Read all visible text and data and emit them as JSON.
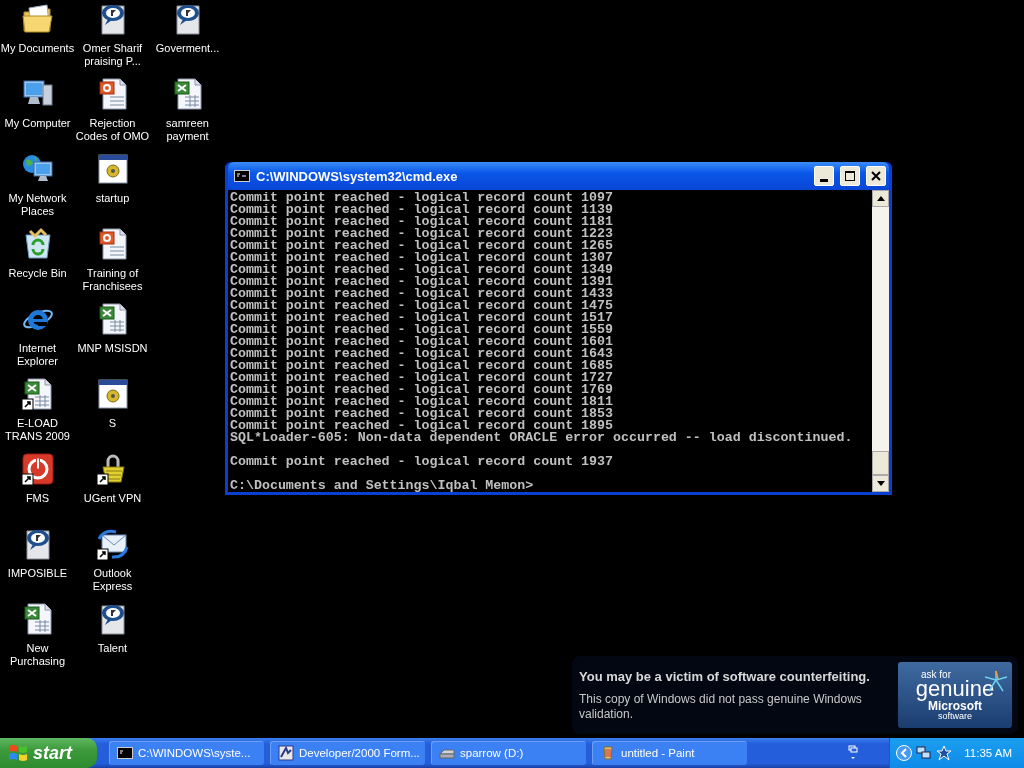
{
  "desktop_icons": [
    {
      "label": "My Documents",
      "kind": "folder",
      "shortcut": false
    },
    {
      "label": "My Computer",
      "kind": "computer",
      "shortcut": false
    },
    {
      "label": "My Network Places",
      "kind": "network",
      "shortcut": false
    },
    {
      "label": "Recycle Bin",
      "kind": "recycle",
      "shortcut": false
    },
    {
      "label": "Internet Explorer",
      "kind": "browser",
      "shortcut": false
    },
    {
      "label": "E-LOAD TRANS 2009",
      "kind": "spreadsheet",
      "shortcut": true
    },
    {
      "label": "FMS",
      "kind": "power",
      "shortcut": true
    },
    {
      "label": "IMPOSIBLE",
      "kind": "media",
      "shortcut": false
    },
    {
      "label": "New Purchasing",
      "kind": "spreadsheet",
      "shortcut": false
    },
    {
      "label": "Omer Sharif praising P...",
      "kind": "media",
      "shortcut": false
    },
    {
      "label": "Rejection Codes of OMO",
      "kind": "presentation",
      "shortcut": false
    },
    {
      "label": "startup",
      "kind": "app",
      "shortcut": false
    },
    {
      "label": "Training of Franchisees",
      "kind": "presentation",
      "shortcut": false
    },
    {
      "label": "MNP MSISDN",
      "kind": "spreadsheet",
      "shortcut": false
    },
    {
      "label": "S",
      "kind": "app",
      "shortcut": false
    },
    {
      "label": "UGent VPN",
      "kind": "vpn",
      "shortcut": true
    },
    {
      "label": "Outlook Express",
      "kind": "mail",
      "shortcut": true
    },
    {
      "label": "Talent",
      "kind": "media",
      "shortcut": false
    },
    {
      "label": "Goverment...",
      "kind": "media",
      "shortcut": false
    },
    {
      "label": "samreen payment",
      "kind": "spreadsheet",
      "shortcut": false
    }
  ],
  "console_window": {
    "title": "C:\\WINDOWS\\system32\\cmd.exe",
    "output_blocks": [
      {
        "lines": [
          "Commit point reached - logical record count 1097",
          "Commit point reached - logical record count 1139",
          "Commit point reached - logical record count 1181",
          "Commit point reached - logical record count 1223",
          "Commit point reached - logical record count 1265",
          "Commit point reached - logical record count 1307",
          "Commit point reached - logical record count 1349",
          "Commit point reached - logical record count 1391",
          "Commit point reached - logical record count 1433",
          "Commit point reached - logical record count 1475",
          "Commit point reached - logical record count 1517",
          "Commit point reached - logical record count 1559",
          "Commit point reached - logical record count 1601",
          "Commit point reached - logical record count 1643",
          "Commit point reached - logical record count 1685",
          "Commit point reached - logical record count 1727",
          "Commit point reached - logical record count 1769",
          "Commit point reached - logical record count 1811",
          "Commit point reached - logical record count 1853",
          "Commit point reached - logical record count 1895",
          "SQL*Loader-605: Non-data dependent ORACLE error occurred -- load discontinued."
        ]
      },
      {
        "lines": [
          "Commit point reached - logical record count 1937"
        ]
      },
      {
        "lines": [
          "C:\\Documents and Settings\\Iqbal Memon>"
        ]
      }
    ]
  },
  "genuine_notice": {
    "title": "You may be a victim of software counterfeiting.",
    "message": "This copy of Windows did not pass genuine Windows validation.",
    "badge": {
      "line_1": "ask for",
      "line_2": "genuine",
      "line_3": "Microsoft",
      "line_4": "software"
    }
  },
  "taskbar": {
    "start_label": "start",
    "tasks": [
      {
        "label": "C:\\WINDOWS\\syste...",
        "kind": "console",
        "selected": false
      },
      {
        "label": "Developer/2000 Form...",
        "kind": "forms",
        "selected": false
      },
      {
        "label": "sparrow (D:)",
        "kind": "drive",
        "selected": false
      },
      {
        "label": "untitled - Paint",
        "kind": "paint",
        "selected": false
      }
    ],
    "clock": "11:35 AM"
  }
}
